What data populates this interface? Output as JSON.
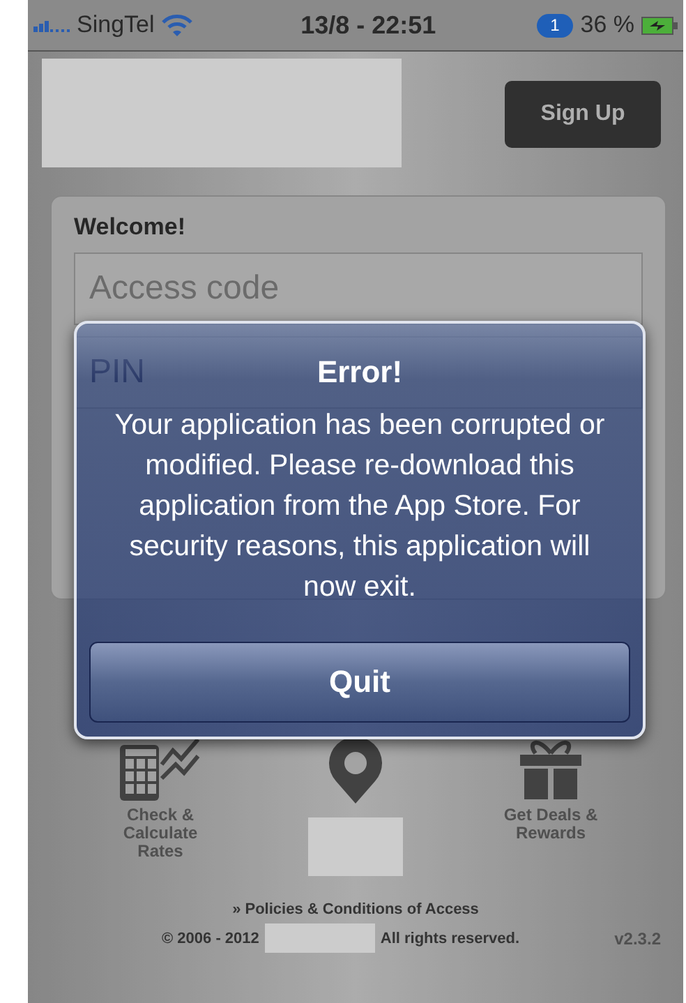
{
  "status_bar": {
    "carrier": "SingTel",
    "time": "13/8 - 22:51",
    "notification_count": "1",
    "battery": "36 %"
  },
  "header": {
    "sign_up": "Sign Up"
  },
  "login_card": {
    "title": "Welcome!",
    "access_code": {
      "placeholder": "Access code"
    },
    "pin": {
      "placeholder": "PIN"
    }
  },
  "alert": {
    "title": "Error!",
    "message": "Your application has been corrupted or modified. Please re-download this application from the App Store. For security reasons, this application will now exit.",
    "buttons": [
      "Quit"
    ]
  },
  "shortcuts": [
    {
      "kind": "rates",
      "label": "Check & Calculate Rates"
    },
    {
      "kind": "location"
    },
    {
      "kind": "gift",
      "label": "Get Deals & Rewards"
    }
  ],
  "footer": {
    "link": "» Policies & Conditions of Access",
    "copyright_start": "© 2006 - 2012",
    "copyright_end": "All rights reserved.",
    "version": "v2.3.2"
  }
}
